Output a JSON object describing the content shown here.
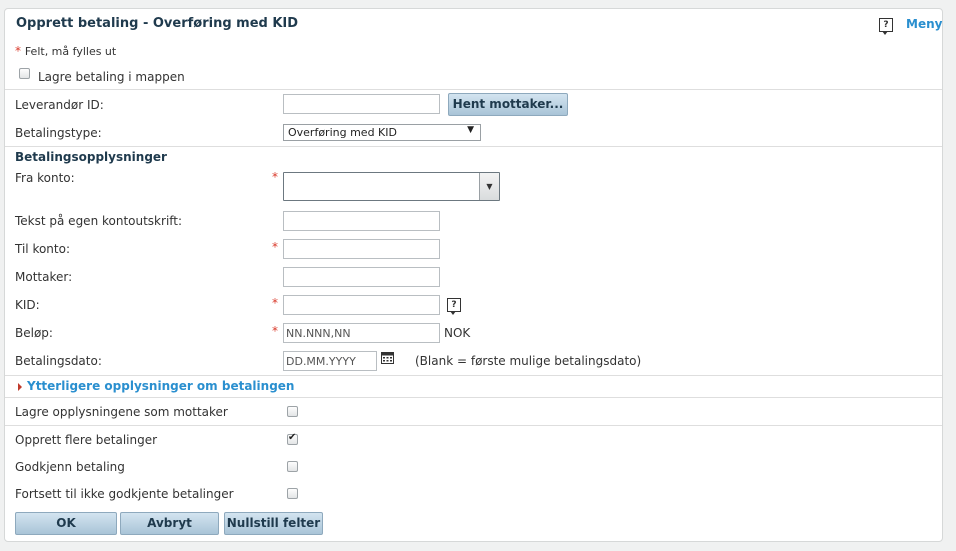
{
  "header": {
    "title": "Opprett betaling - Overføring med KID",
    "menu_label": "Meny"
  },
  "required_note": {
    "star": "*",
    "text": "Felt, må fylles ut"
  },
  "save_to_folder": {
    "label": "Lagre betaling i mappen",
    "checked": false
  },
  "supplier": {
    "label": "Leverandør ID:",
    "value": "",
    "fetch_button": "Hent mottaker..."
  },
  "payment_type": {
    "label": "Betalingstype:",
    "selected": "Overføring med KID"
  },
  "section_title": "Betalingsopplysninger",
  "fields": {
    "from_account": {
      "label": "Fra konto:",
      "required": "*",
      "value": ""
    },
    "own_statement_text": {
      "label": "Tekst på egen kontoutskrift:",
      "value": ""
    },
    "to_account": {
      "label": "Til konto:",
      "required": "*",
      "value": ""
    },
    "recipient": {
      "label": "Mottaker:",
      "value": ""
    },
    "kid": {
      "label": "KID:",
      "required": "*",
      "value": ""
    },
    "amount": {
      "label": "Beløp:",
      "required": "*",
      "placeholder": "NN.NNN,NN",
      "currency": "NOK"
    },
    "payment_date": {
      "label": "Betalingsdato:",
      "placeholder": "DD.MM.YYYY",
      "hint": "(Blank = første mulige betalingsdato)"
    }
  },
  "more_info_link": "Ytterligere opplysninger om betalingen",
  "options": {
    "save_as_recipient": {
      "label": "Lagre opplysningene som mottaker",
      "checked": false
    },
    "create_multiple": {
      "label": "Opprett flere betalinger",
      "checked": true
    },
    "approve": {
      "label": "Godkjenn betaling",
      "checked": false
    },
    "continue_unapproved": {
      "label": "Fortsett til ikke godkjente betalinger",
      "checked": false
    }
  },
  "buttons": {
    "ok": "OK",
    "cancel": "Avbryt",
    "reset": "Nullstill felter"
  },
  "icons": {
    "help": "help-icon",
    "calendar": "calendar-icon",
    "dropdown": "chevron-down-icon",
    "expander": "triangle-right-icon"
  }
}
